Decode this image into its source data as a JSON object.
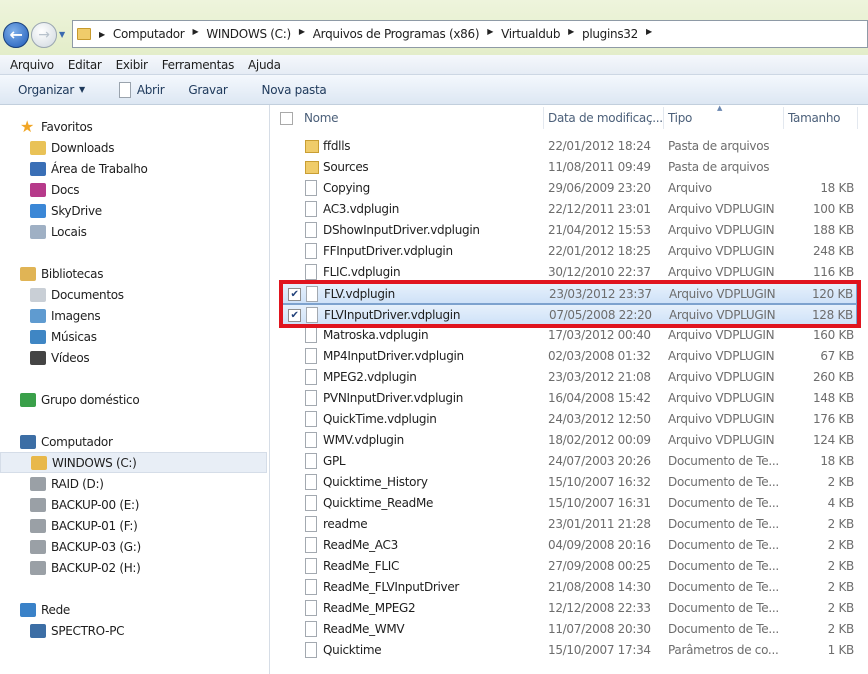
{
  "address": {
    "crumbs": [
      "Computador",
      "WINDOWS (C:)",
      "Arquivos de Programas (x86)",
      "Virtualdub",
      "plugins32"
    ]
  },
  "menu": [
    "Arquivo",
    "Editar",
    "Exibir",
    "Ferramentas",
    "Ajuda"
  ],
  "toolbar": {
    "organize": "Organizar",
    "open": "Abrir",
    "burn": "Gravar",
    "new_folder": "Nova pasta"
  },
  "sidebar": [
    {
      "label": "Favoritos",
      "group": true,
      "icon": "star-icon",
      "color": "#f1a626"
    },
    {
      "label": "Downloads",
      "icon": "downloads-folder-icon",
      "color": "#e9c257"
    },
    {
      "label": "Área de Trabalho",
      "icon": "desktop-icon",
      "color": "#3a6fb6"
    },
    {
      "label": "Docs",
      "icon": "docs-icon",
      "color": "#b63a8a"
    },
    {
      "label": "SkyDrive",
      "icon": "skydrive-icon",
      "color": "#3b87d6"
    },
    {
      "label": "Locais",
      "icon": "recent-places-icon",
      "color": "#9fb0c4"
    },
    {
      "label": "Bibliotecas",
      "group": true,
      "icon": "libraries-icon",
      "color": "#e0b455"
    },
    {
      "label": "Documentos",
      "icon": "documents-icon",
      "color": "#c9cfd6"
    },
    {
      "label": "Imagens",
      "icon": "pictures-icon",
      "color": "#5f9bd0"
    },
    {
      "label": "Músicas",
      "icon": "music-icon",
      "color": "#3f86c4"
    },
    {
      "label": "Vídeos",
      "icon": "videos-icon",
      "color": "#444"
    },
    {
      "label": "Grupo doméstico",
      "group": true,
      "icon": "homegroup-icon",
      "color": "#3aa04a"
    },
    {
      "label": "Computador",
      "group": true,
      "icon": "computer-icon",
      "color": "#3c6ea5"
    },
    {
      "label": "WINDOWS (C:)",
      "icon": "drive-windows-icon",
      "color": "#e8b84a",
      "selected": true
    },
    {
      "label": "RAID (D:)",
      "icon": "drive-icon",
      "color": "#9aa0a6"
    },
    {
      "label": "BACKUP-00 (E:)",
      "icon": "drive-icon",
      "color": "#9aa0a6"
    },
    {
      "label": "BACKUP-01 (F:)",
      "icon": "drive-icon",
      "color": "#9aa0a6"
    },
    {
      "label": "BACKUP-03 (G:)",
      "icon": "drive-icon",
      "color": "#9aa0a6"
    },
    {
      "label": "BACKUP-02 (H:)",
      "icon": "drive-icon",
      "color": "#9aa0a6"
    },
    {
      "label": "Rede",
      "group": true,
      "icon": "network-icon",
      "color": "#3a82c8"
    },
    {
      "label": "SPECTRO-PC",
      "icon": "pc-icon",
      "color": "#3c6ea5"
    }
  ],
  "columns": {
    "name": "Nome",
    "date": "Data de modificaç...",
    "type": "Tipo",
    "size": "Tamanho"
  },
  "files": [
    {
      "name": "ffdlls",
      "date": "22/01/2012 18:24",
      "type": "Pasta de arquivos",
      "size": "",
      "dir": true
    },
    {
      "name": "Sources",
      "date": "11/08/2011 09:49",
      "type": "Pasta de arquivos",
      "size": "",
      "dir": true
    },
    {
      "name": "Copying",
      "date": "29/06/2009 23:20",
      "type": "Arquivo",
      "size": "18 KB"
    },
    {
      "name": "AC3.vdplugin",
      "date": "22/12/2011 23:01",
      "type": "Arquivo VDPLUGIN",
      "size": "100 KB"
    },
    {
      "name": "DShowInputDriver.vdplugin",
      "date": "21/04/2012 15:53",
      "type": "Arquivo VDPLUGIN",
      "size": "188 KB"
    },
    {
      "name": "FFInputDriver.vdplugin",
      "date": "22/01/2012 18:25",
      "type": "Arquivo VDPLUGIN",
      "size": "248 KB"
    },
    {
      "name": "FLIC.vdplugin",
      "date": "30/12/2010 22:37",
      "type": "Arquivo VDPLUGIN",
      "size": "116 KB"
    },
    {
      "name": "FLV.vdplugin",
      "date": "23/03/2012 23:37",
      "type": "Arquivo VDPLUGIN",
      "size": "120 KB",
      "selected": true
    },
    {
      "name": "FLVInputDriver.vdplugin",
      "date": "07/05/2008 22:20",
      "type": "Arquivo VDPLUGIN",
      "size": "128 KB",
      "selected": true
    },
    {
      "name": "Matroska.vdplugin",
      "date": "17/03/2012 00:40",
      "type": "Arquivo VDPLUGIN",
      "size": "160 KB"
    },
    {
      "name": "MP4InputDriver.vdplugin",
      "date": "02/03/2008 01:32",
      "type": "Arquivo VDPLUGIN",
      "size": "67 KB"
    },
    {
      "name": "MPEG2.vdplugin",
      "date": "23/03/2012 21:08",
      "type": "Arquivo VDPLUGIN",
      "size": "260 KB"
    },
    {
      "name": "PVNInputDriver.vdplugin",
      "date": "16/04/2008 15:42",
      "type": "Arquivo VDPLUGIN",
      "size": "148 KB"
    },
    {
      "name": "QuickTime.vdplugin",
      "date": "24/03/2012 12:50",
      "type": "Arquivo VDPLUGIN",
      "size": "176 KB"
    },
    {
      "name": "WMV.vdplugin",
      "date": "18/02/2012 00:09",
      "type": "Arquivo VDPLUGIN",
      "size": "124 KB"
    },
    {
      "name": "GPL",
      "date": "24/07/2003 20:26",
      "type": "Documento de Te...",
      "size": "18 KB"
    },
    {
      "name": "Quicktime_History",
      "date": "15/10/2007 16:32",
      "type": "Documento de Te...",
      "size": "2 KB"
    },
    {
      "name": "Quicktime_ReadMe",
      "date": "15/10/2007 16:31",
      "type": "Documento de Te...",
      "size": "4 KB"
    },
    {
      "name": "readme",
      "date": "23/01/2011 21:28",
      "type": "Documento de Te...",
      "size": "2 KB"
    },
    {
      "name": "ReadMe_AC3",
      "date": "04/09/2008 20:16",
      "type": "Documento de Te...",
      "size": "2 KB"
    },
    {
      "name": "ReadMe_FLIC",
      "date": "27/09/2008 00:25",
      "type": "Documento de Te...",
      "size": "2 KB"
    },
    {
      "name": "ReadMe_FLVInputDriver",
      "date": "21/08/2008 14:30",
      "type": "Documento de Te...",
      "size": "2 KB"
    },
    {
      "name": "ReadMe_MPEG2",
      "date": "12/12/2008 22:33",
      "type": "Documento de Te...",
      "size": "2 KB"
    },
    {
      "name": "ReadMe_WMV",
      "date": "11/07/2008 20:30",
      "type": "Documento de Te...",
      "size": "2 KB"
    },
    {
      "name": "Quicktime",
      "date": "15/10/2007 17:34",
      "type": "Parâmetros de co...",
      "size": "1 KB"
    }
  ],
  "colors": {
    "highlight_box": "#e0141e"
  }
}
